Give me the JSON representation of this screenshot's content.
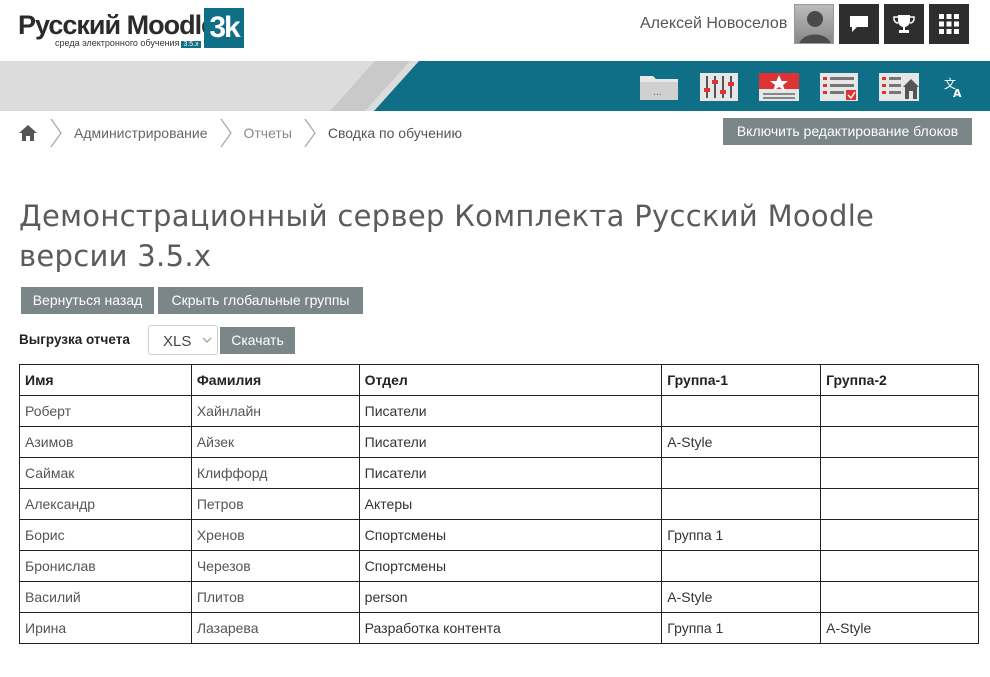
{
  "header": {
    "logo_title": "Русский Moodle",
    "logo_subtitle": "среда электронного обучения",
    "logo_version": "3.5.x",
    "logo_badge": "3k",
    "username": "Алексей Новоселов",
    "icons": [
      "messages-icon",
      "trophy-icon",
      "grid-icon"
    ]
  },
  "navbar": {
    "icons": [
      "folder-icon",
      "sliders-icon",
      "star-card-icon",
      "report-icon",
      "home-course-icon",
      "translate-icon"
    ]
  },
  "breadcrumb": {
    "home": "home-icon",
    "items": [
      "Администрирование",
      "Отчеты",
      "Сводка по обучению"
    ]
  },
  "edit_blocks_button": "Включить редактирование блоков",
  "page_title": "Демонстрационный сервер Комплекта Русский Moodle версии 3.5.x",
  "actions": {
    "back": "Вернуться назад",
    "hide_groups": "Скрыть глобальные группы"
  },
  "export": {
    "label": "Выгрузка отчета",
    "format": "XLS",
    "download": "Скачать"
  },
  "table": {
    "headers": [
      "Имя",
      "Фамилия",
      "Отдел",
      "Группа-1",
      "Группа-2"
    ],
    "rows": [
      [
        "Роберт",
        "Хайнлайн",
        "Писатели",
        "",
        ""
      ],
      [
        "Азимов",
        "Айзек",
        "Писатели",
        "A-Style",
        ""
      ],
      [
        "Саймак",
        "Клиффорд",
        "Писатели",
        "",
        ""
      ],
      [
        "Александр",
        "Петров",
        "Актеры",
        "",
        ""
      ],
      [
        "Борис",
        "Хренов",
        "Спортсмены",
        "Группа 1",
        ""
      ],
      [
        "Бронислав",
        "Черезов",
        "Спортсмены",
        "",
        ""
      ],
      [
        "Василий",
        "Плитов",
        "person",
        "A-Style",
        ""
      ],
      [
        "Ирина",
        "Лазарева",
        "Разработка контента",
        "Группа 1",
        "A-Style"
      ]
    ]
  },
  "colors": {
    "accent": "#0f6f86",
    "button": "#7b8689",
    "dark_button": "#2e2e2e"
  }
}
